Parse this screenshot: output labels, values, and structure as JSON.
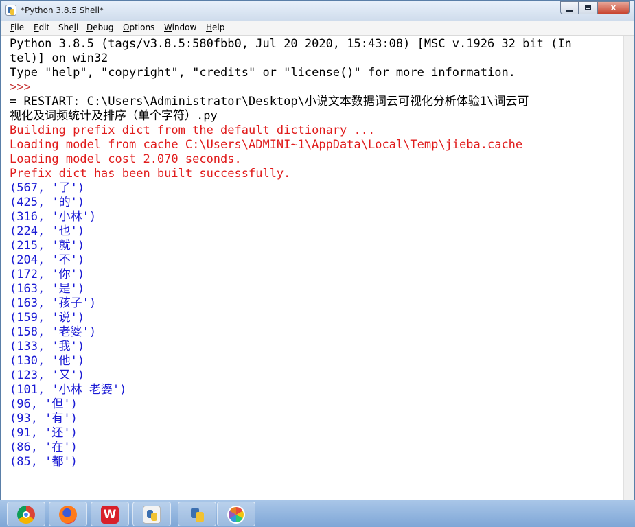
{
  "window": {
    "title": "*Python 3.8.5 Shell*",
    "controls": {
      "minimize": "",
      "maximize": "",
      "close": "x"
    }
  },
  "menu": [
    {
      "underline": "F",
      "rest": "ile"
    },
    {
      "underline": "E",
      "rest": "dit"
    },
    {
      "underline": "",
      "rest": "Shell",
      "pre": "She",
      "under_mid": "l",
      "post": "l"
    },
    {
      "underline": "D",
      "rest": "ebug"
    },
    {
      "underline": "O",
      "rest": "ptions"
    },
    {
      "underline": "W",
      "rest": "indow"
    },
    {
      "underline": "H",
      "rest": "elp"
    }
  ],
  "shell": {
    "lines": [
      {
        "text": "Python 3.8.5 (tags/v3.8.5:580fbb0, Jul 20 2020, 15:43:08) [MSC v.1926 32 bit (In",
        "color": "black"
      },
      {
        "text": "tel)] on win32",
        "color": "black"
      },
      {
        "text": "Type \"help\", \"copyright\", \"credits\" or \"license()\" for more information.",
        "color": "black"
      },
      {
        "text": ">>> ",
        "color": "prompt"
      },
      {
        "text": "= RESTART: C:\\Users\\Administrator\\Desktop\\小说文本数据词云可视化分析体验1\\词云可",
        "color": "black"
      },
      {
        "text": "视化及词频统计及排序（单个字符）.py",
        "color": "black"
      },
      {
        "text": "Building prefix dict from the default dictionary ...",
        "color": "red"
      },
      {
        "text": "Loading model from cache C:\\Users\\ADMINI~1\\AppData\\Local\\Temp\\jieba.cache",
        "color": "red"
      },
      {
        "text": "Loading model cost 2.070 seconds.",
        "color": "red"
      },
      {
        "text": "Prefix dict has been built successfully.",
        "color": "red"
      },
      {
        "text": "(567, '了')",
        "color": "blue"
      },
      {
        "text": "(425, '的')",
        "color": "blue"
      },
      {
        "text": "(316, '小林')",
        "color": "blue"
      },
      {
        "text": "(224, '也')",
        "color": "blue"
      },
      {
        "text": "(215, '就')",
        "color": "blue"
      },
      {
        "text": "(204, '不')",
        "color": "blue"
      },
      {
        "text": "(172, '你')",
        "color": "blue"
      },
      {
        "text": "(163, '是')",
        "color": "blue"
      },
      {
        "text": "(163, '孩子')",
        "color": "blue"
      },
      {
        "text": "(159, '说')",
        "color": "blue"
      },
      {
        "text": "(158, '老婆')",
        "color": "blue"
      },
      {
        "text": "(133, '我')",
        "color": "blue"
      },
      {
        "text": "(130, '他')",
        "color": "blue"
      },
      {
        "text": "(123, '又')",
        "color": "blue"
      },
      {
        "text": "(101, '小林 老婆')",
        "color": "blue"
      },
      {
        "text": "(96, '但')",
        "color": "blue"
      },
      {
        "text": "(93, '有')",
        "color": "blue"
      },
      {
        "text": "(91, '还')",
        "color": "blue"
      },
      {
        "text": "(86, '在')",
        "color": "blue"
      },
      {
        "text": "(85, '都')",
        "color": "blue"
      }
    ]
  },
  "taskbar": {
    "apps": [
      {
        "name": "chrome-icon",
        "label": ""
      },
      {
        "name": "firefox-icon",
        "label": ""
      },
      {
        "name": "wps-icon",
        "label": "W"
      },
      {
        "name": "python-icon",
        "label": ""
      },
      {
        "name": "launcher-icon",
        "label": ""
      },
      {
        "name": "pinwheel-icon",
        "label": ""
      }
    ]
  },
  "colors": {
    "output_red": "#e01b1b",
    "result_blue": "#1a1ad4",
    "prompt": "#c83a3a"
  }
}
